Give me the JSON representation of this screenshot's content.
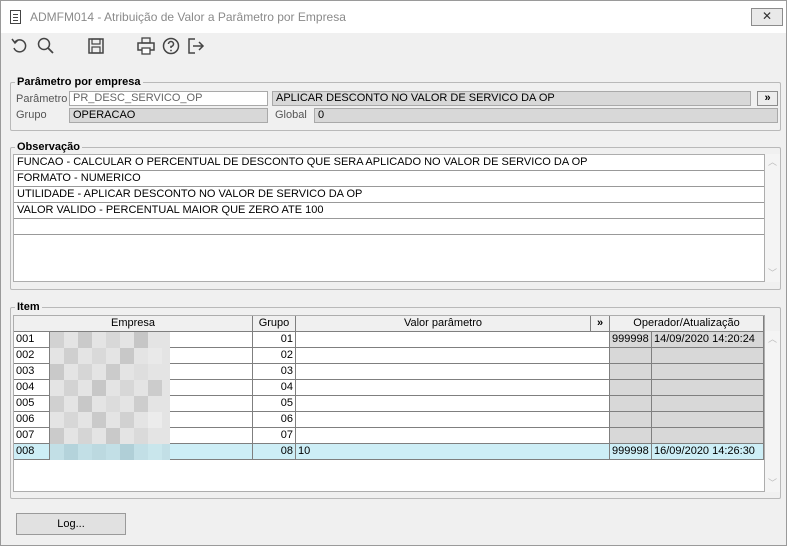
{
  "window": {
    "title": "ADMFM014 - Atribuição de Valor a Parâmetro por Empresa",
    "close_label": "✕"
  },
  "toolbar": {
    "icons": [
      "undo-icon",
      "search-icon",
      "save-icon",
      "print-icon",
      "help-icon",
      "exit-icon"
    ]
  },
  "param_group": {
    "legend": "Parâmetro por empresa",
    "parametro_label": "Parâmetro",
    "parametro_value": "PR_DESC_SERVICO_OP",
    "descricao_value": "APLICAR DESCONTO NO VALOR DE SERVICO DA OP",
    "expand_label": "»",
    "grupo_label": "Grupo",
    "grupo_value": "OPERACAO",
    "global_label": "Global",
    "global_value": "0"
  },
  "observacao": {
    "legend": "Observação",
    "lines": [
      "FUNCAO - CALCULAR O PERCENTUAL DE DESCONTO QUE SERA APLICADO NO VALOR DE SERVICO DA OP",
      "FORMATO - NUMERICO",
      "UTILIDADE - APLICAR DESCONTO NO VALOR DE SERVICO DA OP",
      "VALOR VALIDO - PERCENTUAL MAIOR QUE ZERO ATE 100",
      ""
    ]
  },
  "item": {
    "legend": "Item",
    "headers": {
      "empresa": "Empresa",
      "grupo": "Grupo",
      "valor": "Valor parâmetro",
      "expand": "»",
      "operador": "Operador/Atualização"
    },
    "rows": [
      {
        "cod": "001",
        "grupo": "01",
        "valor": "",
        "operador": "999998",
        "data": "14/09/2020 14:20:24"
      },
      {
        "cod": "002",
        "grupo": "02",
        "valor": "",
        "operador": "",
        "data": ""
      },
      {
        "cod": "003",
        "grupo": "03",
        "valor": "",
        "operador": "",
        "data": ""
      },
      {
        "cod": "004",
        "grupo": "04",
        "valor": "",
        "operador": "",
        "data": ""
      },
      {
        "cod": "005",
        "grupo": "05",
        "valor": "",
        "operador": "",
        "data": ""
      },
      {
        "cod": "006",
        "grupo": "06",
        "valor": "",
        "operador": "",
        "data": ""
      },
      {
        "cod": "007",
        "grupo": "07",
        "valor": "",
        "operador": "",
        "data": ""
      },
      {
        "cod": "008",
        "grupo": "08",
        "valor": "10",
        "operador": "999998",
        "data": "16/09/2020 14:26:30"
      }
    ]
  },
  "footer": {
    "log_label": "Log..."
  },
  "colors": {
    "selected_row": "#cdeef6",
    "readonly_field": "#d8d8d8"
  }
}
